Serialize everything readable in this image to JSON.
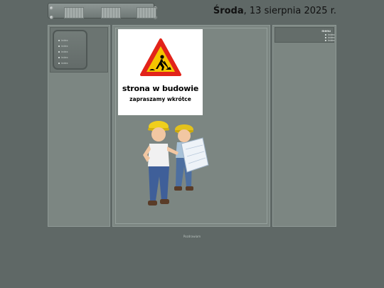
{
  "header": {
    "day": "Środa",
    "date_rest": ", 13 sierpnia 2025 r."
  },
  "left_menu": {
    "items": [
      "index",
      "index",
      "index",
      "index",
      "index"
    ]
  },
  "right_menu": {
    "title": "menu",
    "items": [
      "index",
      "index",
      "index"
    ]
  },
  "sign": {
    "title": "strona w budowie",
    "subtitle": "zapraszamy wkrótce",
    "icon": "under-construction-warning-icon"
  },
  "footer": {
    "text": "Pozdrawiam"
  },
  "colors": {
    "background": "#5f6866",
    "panel": "#7c8682",
    "sign_yellow": "#f5c400",
    "sign_red": "#e2231a"
  }
}
